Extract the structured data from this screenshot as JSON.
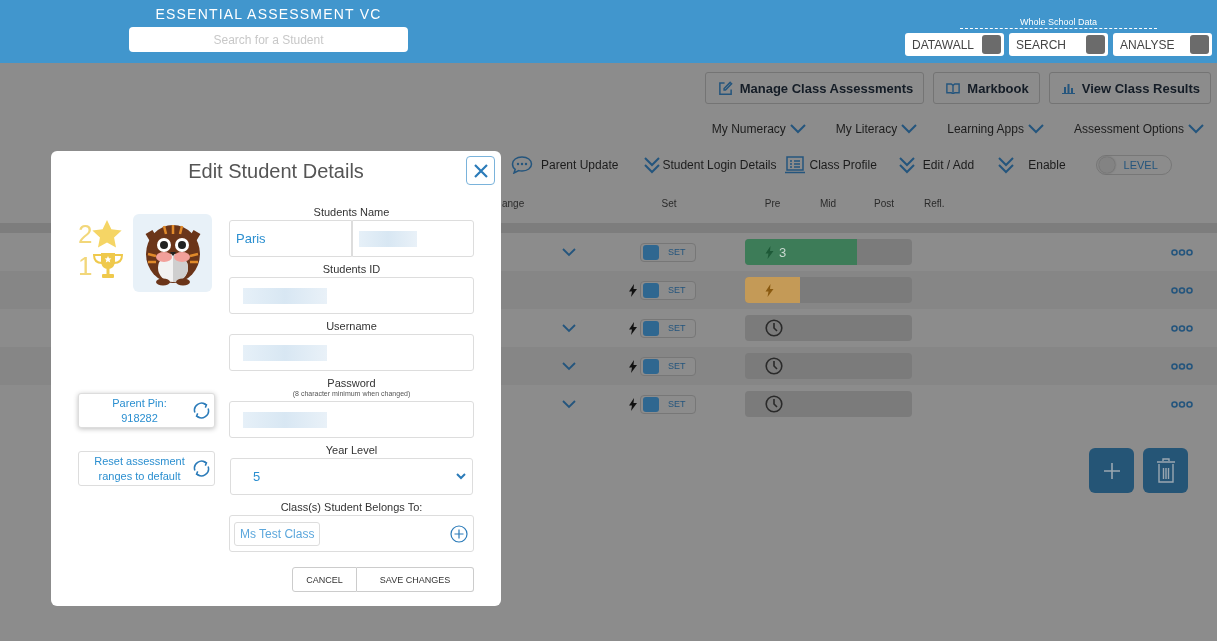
{
  "header": {
    "title": "ESSENTIAL ASSESSMENT VC",
    "search_placeholder": "Search for a Student",
    "group_label": "Whole School Data",
    "toggles": [
      {
        "label": "DATAWALL",
        "on": false
      },
      {
        "label": "SEARCH",
        "on": false
      },
      {
        "label": "ANALYSE",
        "on": false
      }
    ]
  },
  "actions": [
    {
      "label": "Manage Class Assessments"
    },
    {
      "label": "Markbook"
    },
    {
      "label": "View Class Results"
    }
  ],
  "menus": [
    {
      "label": "My Numeracy"
    },
    {
      "label": "My Literacy"
    },
    {
      "label": "Learning Apps"
    },
    {
      "label": "Assessment Options"
    }
  ],
  "toolbar": [
    {
      "label": "Parent Update"
    },
    {
      "label": "Student Login Details"
    },
    {
      "label": "Class Profile"
    },
    {
      "label": "Edit / Add"
    },
    {
      "label": "Enable"
    }
  ],
  "level_toggle": {
    "label": "LEVEL",
    "on": false
  },
  "columns": [
    "ange",
    "Set",
    "Pre",
    "Mid",
    "Post",
    "Refl."
  ],
  "rows": [
    {
      "expandable": true,
      "flash": false,
      "set": {
        "label": "SET",
        "on": true
      },
      "pre": {
        "kind": "done",
        "level": 0.67,
        "color": "#3d7c58",
        "text": "3"
      }
    },
    {
      "expandable": false,
      "flash": true,
      "set": {
        "label": "SET",
        "on": true
      },
      "pre": {
        "kind": "done",
        "level": 0.33,
        "color": "#c49a57"
      }
    },
    {
      "expandable": true,
      "flash": true,
      "set": {
        "label": "SET",
        "on": true
      },
      "pre": {
        "kind": "pending"
      }
    },
    {
      "expandable": true,
      "flash": true,
      "set": {
        "label": "SET",
        "on": true
      },
      "pre": {
        "kind": "pending"
      }
    },
    {
      "expandable": true,
      "flash": true,
      "set": {
        "label": "SET",
        "on": true
      },
      "pre": {
        "kind": "pending"
      }
    }
  ],
  "modal": {
    "title": "Edit Student Details",
    "star_count": "2",
    "trophy_count": "1",
    "parent_pin": {
      "label": "Parent Pin:",
      "value": "918282"
    },
    "reset_label": "Reset assessment ranges to default",
    "fields": [
      {
        "kind": "name",
        "label": "Students Name",
        "first": "Paris",
        "redacted": true
      },
      {
        "kind": "text",
        "label": "Students ID",
        "redacted": true
      },
      {
        "kind": "text",
        "label": "Username",
        "redacted": true
      },
      {
        "kind": "text",
        "label": "Password",
        "hint": "(8 character minimum when changed)",
        "redacted": true
      },
      {
        "kind": "select",
        "label": "Year Level",
        "value": "5"
      },
      {
        "kind": "chips",
        "label": "Class(s) Student Belongs To:",
        "chips": [
          "Ms Test Class"
        ]
      }
    ],
    "buttons": [
      "CANCEL",
      "SAVE CHANGES"
    ]
  }
}
